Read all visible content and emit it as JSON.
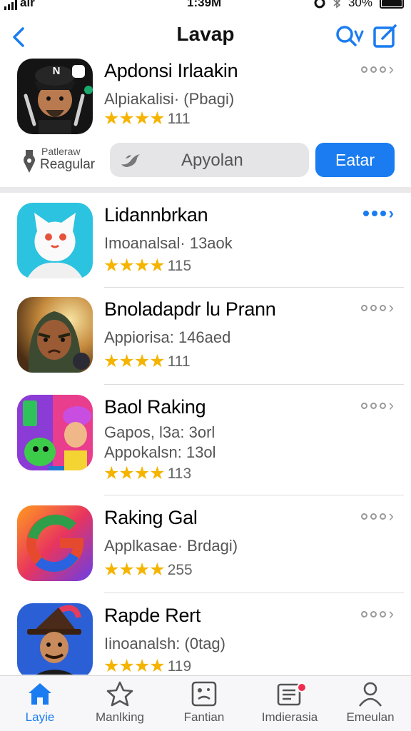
{
  "status": {
    "carrier": "air",
    "time": "1:39M",
    "battery": "30%"
  },
  "nav": {
    "title": "Lavap"
  },
  "featured": {
    "name": "Apdonsi Irlaakin",
    "subtitle": "Alpiakalisi· (Pbagi)",
    "rating": 4,
    "count": "111",
    "secondary_small": "Patleraw",
    "secondary_label": "Reagular",
    "field_value": "Apyolan",
    "action_label": "Eatar"
  },
  "apps": [
    {
      "name": "Lidannbrkan",
      "lines": [
        "Imoanalsal· 13aok"
      ],
      "rating": 4,
      "count": "115",
      "highlight": true
    },
    {
      "name": "Bnoladapdr lu Prann",
      "lines": [
        "Appiorisa: 146aed"
      ],
      "rating": 4,
      "count": "111",
      "highlight": false
    },
    {
      "name": "Baol Raking",
      "lines": [
        "Gapos, l3a: 3orl",
        "Appokalsn: 13ol"
      ],
      "rating": 4,
      "count": "113",
      "highlight": false
    },
    {
      "name": "Raking Gal",
      "lines": [
        "Applkasae· Brdagi)"
      ],
      "rating": 4,
      "count": "255",
      "highlight": false
    },
    {
      "name": "Rapde Rert",
      "lines": [
        "Iinoanalsh: (0tag)"
      ],
      "rating": 4,
      "count": "119",
      "highlight": false
    }
  ],
  "tabs": [
    {
      "label": "Layie",
      "icon": "home-icon",
      "active": true
    },
    {
      "label": "Manlking",
      "icon": "star-icon",
      "active": false
    },
    {
      "label": "Fantian",
      "icon": "games-icon",
      "active": false
    },
    {
      "label": "Imdierasia",
      "icon": "news-icon",
      "active": false
    },
    {
      "label": "Emeulan",
      "icon": "person-icon",
      "active": false
    }
  ],
  "colors": {
    "accent": "#1a7cf0",
    "star": "#f5b400",
    "badge": "#ef2b50"
  }
}
